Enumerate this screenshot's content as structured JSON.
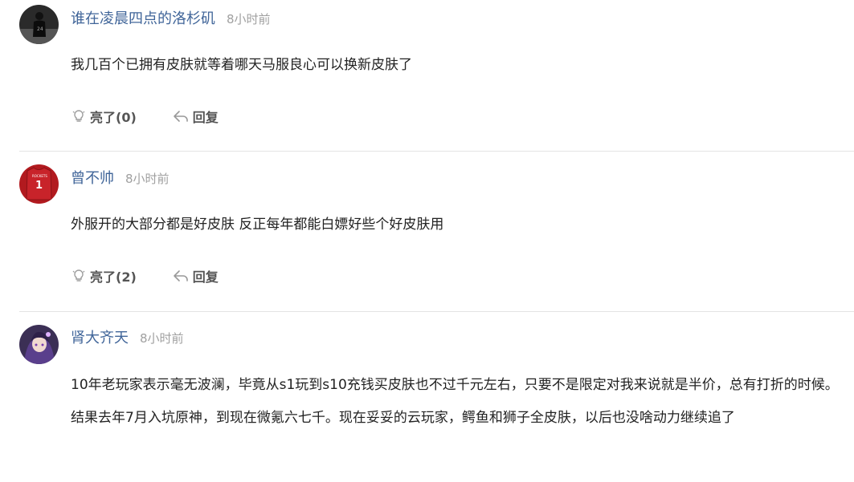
{
  "comments": [
    {
      "username": "谁在凌晨四点的洛杉矶",
      "time": "8小时前",
      "text": "我几百个已拥有皮肤就等着哪天马服良心可以换新皮肤了",
      "like_label": "亮了(0)",
      "reply_label": "回复",
      "avatar_icon": "player-silhouette-avatar"
    },
    {
      "username": "曾不帅",
      "time": "8小时前",
      "text": "外服开的大部分都是好皮肤 反正每年都能白嫖好些个好皮肤用",
      "like_label": "亮了(2)",
      "reply_label": "回复",
      "avatar_icon": "red-jersey-avatar"
    },
    {
      "username": "肾大齐天",
      "time": "8小时前",
      "text": "10年老玩家表示毫无波澜，毕竟从s1玩到s10充钱买皮肤也不过千元左右，只要不是限定对我来说就是半价，总有打折的时候。结果去年7月入坑原神，到现在微氪六七千。现在妥妥的云玩家，鳄鱼和狮子全皮肤，以后也没啥动力继续追了",
      "avatar_icon": "anime-character-avatar"
    }
  ],
  "colors": {
    "username": "#406599",
    "time": "#a0a0a0",
    "divider": "#e4e4e4"
  }
}
